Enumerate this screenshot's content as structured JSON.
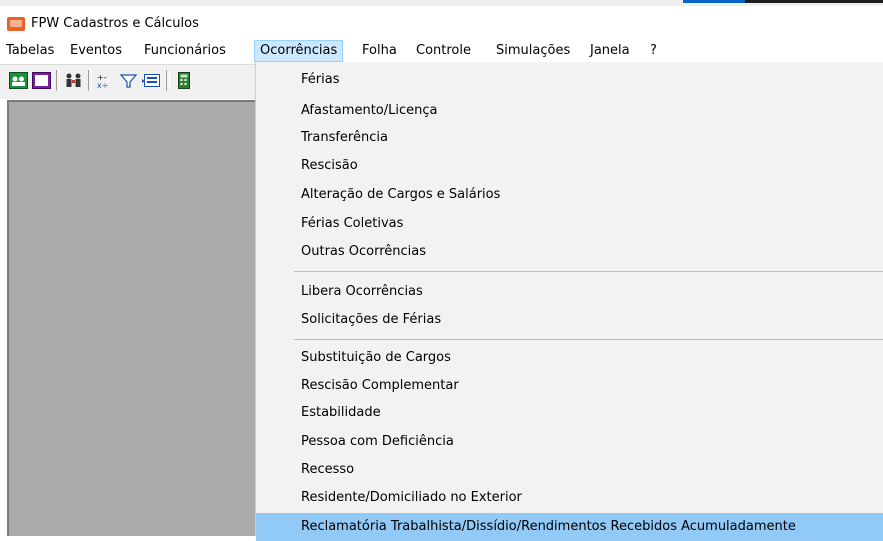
{
  "window": {
    "title": "FPW  Cadastros e Cálculos"
  },
  "menubar": {
    "items": [
      {
        "label": "Tabelas"
      },
      {
        "label": "Eventos"
      },
      {
        "label": "Funcionários"
      },
      {
        "label": "Ocorrências",
        "active": true
      },
      {
        "label": "Folha"
      },
      {
        "label": "Controle"
      },
      {
        "label": "Simulações"
      },
      {
        "label": "Janela"
      },
      {
        "label": "?"
      }
    ]
  },
  "toolbar": {
    "icons": [
      "people-card-icon",
      "window-icon",
      "employees-icon",
      "calc-symbols-icon",
      "filter-icon",
      "form-icon",
      "calculator-icon"
    ]
  },
  "dropdown": {
    "groups": [
      {
        "items": [
          "Férias",
          "Afastamento/Licença",
          "Transferência",
          "Rescisão",
          "Alteração de Cargos e Salários",
          "Férias Coletivas",
          "Outras Ocorrências"
        ]
      },
      {
        "items": [
          "Libera Ocorrências",
          "Solicitações de Férias"
        ]
      },
      {
        "items": [
          "Substituição de Cargos",
          "Rescisão Complementar",
          "Estabilidade",
          "Pessoa com Deficiência",
          "Recesso",
          "Residente/Domiciliado no Exterior",
          "Reclamatória Trabalhista/Dissídio/Rendimentos Recebidos Acumuladamente"
        ]
      }
    ],
    "highlighted": "Reclamatória Trabalhista/Dissídio/Rendimentos Recebidos Acumuladamente"
  },
  "colors": {
    "menu_highlight": "#91c9f7",
    "active_menu_bg": "#cce8ff",
    "workspace": "#ababab"
  }
}
